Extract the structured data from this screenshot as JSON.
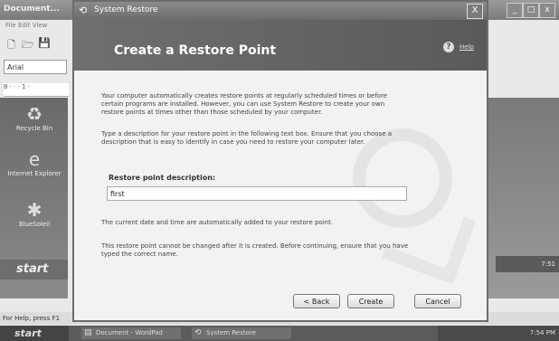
{
  "background": {
    "window_title": "Document...",
    "menu": "File  Edit  View",
    "font_name": "Arial",
    "ruler": "8 · · · 1 ·",
    "desktop_icons": [
      {
        "label": "Recycle Bin"
      },
      {
        "label": "Internet Explorer"
      },
      {
        "label": "BlueSoleil"
      }
    ],
    "mini_start": "start",
    "mini_tray_time": "7:51",
    "statusbar": "For Help, press F1"
  },
  "dialog": {
    "title": "System Restore",
    "close": "X",
    "heading": "Create a Restore Point",
    "help": "Help",
    "intro": "Your computer automatically creates restore points at regularly scheduled times or before certain programs are installed. However, you can use System Restore to create your own restore points at times other than those scheduled by your computer.",
    "instruction": "Type a description for your restore point in the following text box. Ensure that you choose a description that is easy to identify in case you need to restore your computer later.",
    "field_label": "Restore point description:",
    "field_value": "first",
    "note_date": "The current date and time are automatically added to your restore point.",
    "note_warning": "This restore point cannot be changed after it is created. Before continuing, ensure that you have typed the correct name.",
    "buttons": {
      "back": "< Back",
      "create": "Create",
      "cancel": "Cancel"
    }
  },
  "taskbar": {
    "start": "start",
    "items": [
      {
        "label": "Document - WordPad"
      },
      {
        "label": "System Restore"
      }
    ],
    "time": "7:54 PM"
  }
}
